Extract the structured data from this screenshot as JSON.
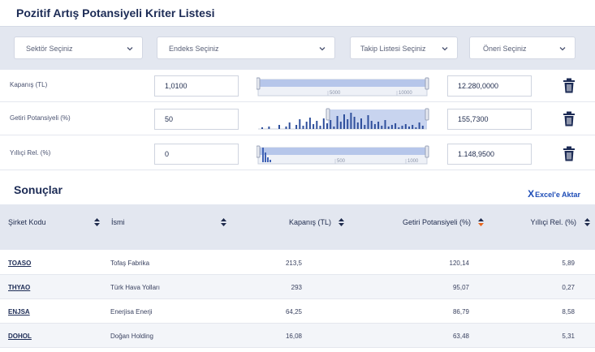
{
  "page": {
    "title": "Pozitif Artış Potansiyeli Kriter Listesi"
  },
  "filters": {
    "sector": {
      "label": "Sektör Seçiniz"
    },
    "index": {
      "label": "Endeks Seçiniz"
    },
    "watchlist": {
      "label": "Takip Listesi Seçiniz"
    },
    "suggestion": {
      "label": "Öneri Seçiniz"
    }
  },
  "criteria": [
    {
      "label": "Kapanış (TL)",
      "min": "1,0100",
      "max": "12.280,0000",
      "ticks": [
        "5000",
        "10000"
      ]
    },
    {
      "label": "Getiri Potansiyeli (%)",
      "min": "50",
      "max": "155,7300",
      "ticks": []
    },
    {
      "label": "Yıllıçi Rel. (%)",
      "min": "0",
      "max": "1.148,9500",
      "ticks": [
        "500",
        "1000"
      ]
    }
  ],
  "results": {
    "title": "Sonuçlar",
    "excel": {
      "icon": "x-excel-icon",
      "label": "Excel'e Aktar"
    },
    "columns": [
      "Şirket Kodu",
      "İsmi",
      "Kapanış (TL)",
      "Getiri Potansiyeli (%)",
      "Yıllıçi Rel. (%)"
    ],
    "rows": [
      {
        "code": "TOASO",
        "name": "Tofaş Fabrika",
        "close": "213,5",
        "potential": "120,14",
        "rel": "5,89"
      },
      {
        "code": "THYAO",
        "name": "Türk Hava Yolları",
        "close": "293",
        "potential": "95,07",
        "rel": "0,27"
      },
      {
        "code": "ENJSA",
        "name": "Enerjisa Enerji",
        "close": "64,25",
        "potential": "86,79",
        "rel": "8,58"
      },
      {
        "code": "DOHOL",
        "name": "Doğan Holding",
        "close": "16,08",
        "potential": "63,48",
        "rel": "5,31"
      }
    ]
  },
  "colors": {
    "primary": "#1c2b55",
    "link": "#1e4db7",
    "panel": "#e3e7f0",
    "slider_fill": "#a9bde8",
    "sort_active": "#e8641b"
  }
}
